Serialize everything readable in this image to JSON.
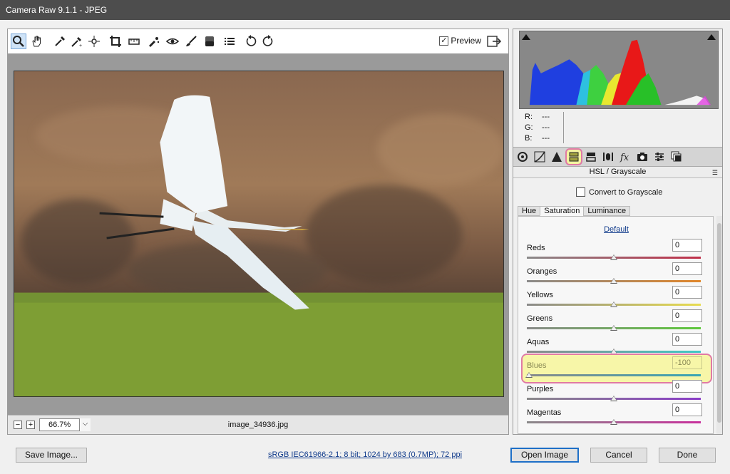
{
  "window": {
    "title": "Camera Raw 9.1.1  -  JPEG"
  },
  "toolbar": {
    "tools": [
      "zoom-tool-icon",
      "hand-tool-icon",
      "white-balance-icon",
      "color-sampler-icon",
      "targeted-adjustment-icon",
      "crop-icon",
      "straighten-icon",
      "spot-removal-icon",
      "red-eye-icon",
      "adjustment-brush-icon",
      "graduated-filter-icon",
      "presets-list-icon",
      "rotate-ccw-icon",
      "rotate-cw-icon"
    ],
    "preview_label": "Preview",
    "preview_checked": true
  },
  "status": {
    "zoom": "66.7%",
    "filename": "image_34936.jpg"
  },
  "histogram": {
    "r_label": "R:",
    "g_label": "G:",
    "b_label": "B:",
    "r_value": "---",
    "g_value": "---",
    "b_value": "---"
  },
  "panel": {
    "title": "HSL / Grayscale",
    "grayscale_label": "Convert to Grayscale",
    "tabs": [
      "Hue",
      "Saturation",
      "Luminance"
    ],
    "selected_tab": "Saturation",
    "default_link": "Default",
    "sliders": [
      {
        "label": "Reds",
        "value": "0",
        "position": 0.5,
        "color": "#c0304a"
      },
      {
        "label": "Oranges",
        "value": "0",
        "position": 0.5,
        "color": "#e0862a"
      },
      {
        "label": "Yellows",
        "value": "0",
        "position": 0.5,
        "color": "#e8dc50"
      },
      {
        "label": "Greens",
        "value": "0",
        "position": 0.5,
        "color": "#5ec83c"
      },
      {
        "label": "Aquas",
        "value": "0",
        "position": 0.5,
        "color": "#40c8c4"
      },
      {
        "label": "Blues",
        "value": "-100",
        "position": 0.0,
        "color": "#3aa6b4"
      },
      {
        "label": "Purples",
        "value": "0",
        "position": 0.5,
        "color": "#8a3cc8"
      },
      {
        "label": "Magentas",
        "value": "0",
        "position": 0.5,
        "color": "#c8309c"
      }
    ]
  },
  "footer": {
    "save_label": "Save Image...",
    "info_link": "sRGB IEC61966-2.1; 8 bit; 1024 by 683 (0.7MP); 72 ppi",
    "open_label": "Open Image",
    "cancel_label": "Cancel",
    "done_label": "Done"
  }
}
